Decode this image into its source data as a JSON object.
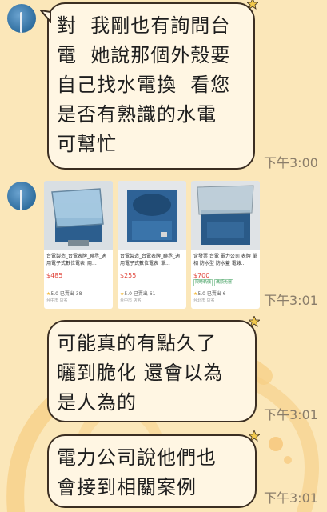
{
  "messages": [
    {
      "type": "text",
      "lines": [
        "對  我剛也有詢問台",
        "電  她說那個外殼要",
        "自己找水電換  看您",
        "是否有熟識的水電",
        "可幫忙"
      ],
      "time": "下午3:00"
    },
    {
      "type": "products",
      "time": "下午3:01",
      "cards": [
        {
          "title": "台電製造_台電表牌_聯丞_適用電子式數位電表_兩...",
          "price": "$485",
          "tags": [],
          "rating": "5.0",
          "sold": "已賣出 38",
          "seller": "台中市 店名"
        },
        {
          "title": "台電製造_台電表牌_聯丞_適用電子式數位電表_單...",
          "price": "$255",
          "tags": [],
          "rating": "5.0",
          "sold": "已賣出 61",
          "seller": "台中市 店名"
        },
        {
          "title": "含發票 台電 電力公司 表牌 單相 防水型 防水蓋 電錶...",
          "price": "$700",
          "tags": [
            "限時執價",
            "滿額免運"
          ],
          "rating": "5.0",
          "sold": "已賣出 6",
          "seller": "台北市 店名"
        }
      ]
    },
    {
      "type": "text",
      "lines": [
        "可能真的有點久了",
        "曬到脆化 還會以為",
        "是人為的"
      ],
      "time": "下午3:01"
    },
    {
      "type": "text",
      "lines": [
        "電力公司說他們也",
        "會接到相關案例"
      ],
      "time": "下午3:01"
    }
  ],
  "colors": {
    "background": "#fbe7b9",
    "bubble": "#fff6e3",
    "bubble_border": "#3b2e22",
    "time": "#8a7d6a",
    "price": "#e0443a"
  }
}
